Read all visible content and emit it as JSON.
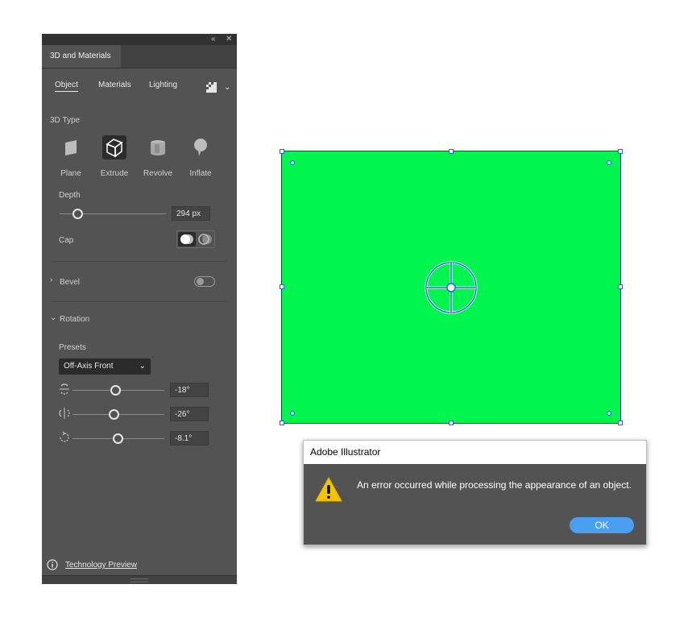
{
  "panel": {
    "title": "3D and Materials",
    "subtabs": [
      "Object",
      "Materials",
      "Lighting"
    ],
    "type_section_label": "3D Type",
    "types": [
      {
        "label": "Plane",
        "icon": "plane-icon"
      },
      {
        "label": "Extrude",
        "icon": "extrude-icon"
      },
      {
        "label": "Revolve",
        "icon": "revolve-icon"
      },
      {
        "label": "Inflate",
        "icon": "inflate-icon"
      }
    ],
    "depth_label": "Depth",
    "depth_value": "294 px",
    "cap_label": "Cap",
    "bevel_label": "Bevel",
    "rotation_label": "Rotation",
    "presets_label": "Presets",
    "preset_value": "Off-Axis Front",
    "rotation_values": [
      "-18°",
      "-26°",
      "-8.1°"
    ],
    "footer": "Technology Preview"
  },
  "dialog": {
    "title": "Adobe Illustrator",
    "message": "An error occurred while processing the appearance of an object.",
    "ok": "OK"
  },
  "colors": {
    "panel_bg": "#535353",
    "artwork_fill": "#00f64f",
    "selection": "#2b63d9",
    "ok_button": "#4a9ff0",
    "warning": "#f5c400"
  }
}
